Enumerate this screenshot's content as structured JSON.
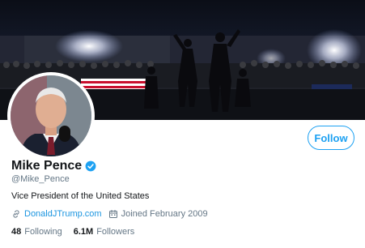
{
  "profile": {
    "name": "Mike Pence",
    "handle": "@Mike_Pence",
    "bio": "Vice President of the United States",
    "website": "DonaldJTrump.com",
    "joined": "Joined February 2009",
    "verified": true
  },
  "actions": {
    "follow_label": "Follow"
  },
  "stats": {
    "following_count": "48",
    "following_label": "Following",
    "followers_count": "6.1M",
    "followers_label": "Followers"
  },
  "icons": {
    "verified": "verified-badge-icon",
    "link": "link-icon",
    "calendar": "calendar-icon"
  },
  "colors": {
    "accent": "#1da1f2",
    "link": "#1b95e0",
    "secondary_text": "#657786",
    "primary_text": "#14171a"
  }
}
